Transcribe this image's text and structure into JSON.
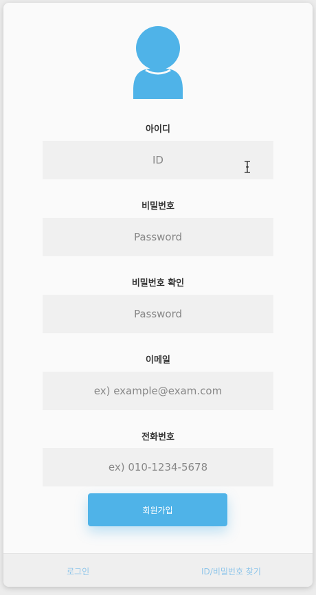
{
  "colors": {
    "accent": "#4fb3e8",
    "link": "#90c6ea",
    "input_bg": "#f0f0f0",
    "card_bg": "#fafafa"
  },
  "icons": {
    "avatar": "user-avatar-icon",
    "cursor": "text-cursor-icon"
  },
  "form": {
    "id": {
      "label": "아이디",
      "placeholder": "ID",
      "value": ""
    },
    "password": {
      "label": "비밀번호",
      "placeholder": "Password",
      "value": ""
    },
    "password_confirm": {
      "label": "비밀번호 확인",
      "placeholder": "Password",
      "value": ""
    },
    "email": {
      "label": "이메일",
      "placeholder": "ex) example@exam.com",
      "value": ""
    },
    "phone": {
      "label": "전화번호",
      "placeholder": "ex) 010-1234-5678",
      "value": ""
    }
  },
  "signup_button": {
    "label": "회원가입"
  },
  "footer": {
    "login_link": "로그인",
    "find_link": "ID/비밀번호 찾기"
  }
}
